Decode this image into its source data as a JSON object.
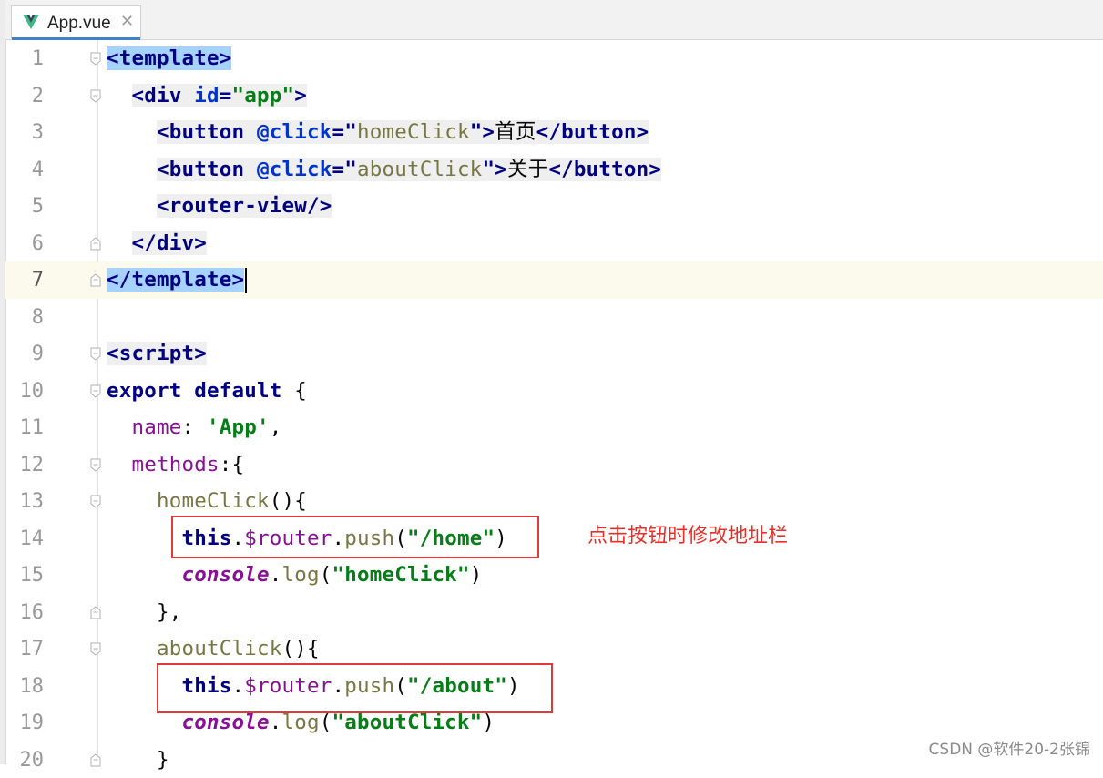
{
  "tab": {
    "file_name": "App.vue",
    "close_glyph": "✕",
    "icon": "vue-logo-icon",
    "accent": "#4083c9"
  },
  "editor": {
    "current_line": 7,
    "lines": [
      {
        "number": "1",
        "tokens": [
          {
            "t": "<template>",
            "c": "tag sel"
          }
        ]
      },
      {
        "number": "2",
        "tokens": [
          {
            "t": "  "
          },
          {
            "t": "<div ",
            "c": "tag bgv"
          },
          {
            "t": "id",
            "c": "attr bgv"
          },
          {
            "t": "=",
            "c": "eq bgv"
          },
          {
            "t": "\"app\"",
            "c": "str bgv"
          },
          {
            "t": ">",
            "c": "tag bgv"
          }
        ]
      },
      {
        "number": "3",
        "tokens": [
          {
            "t": "    "
          },
          {
            "t": "<button ",
            "c": "tag bgv"
          },
          {
            "t": "@click",
            "c": "attr bgv"
          },
          {
            "t": "=\"",
            "c": "eq bgv"
          },
          {
            "t": "homeClick",
            "c": "fn bgv"
          },
          {
            "t": "\">",
            "c": "eq bgv"
          },
          {
            "t": "首页",
            "c": "cjk bgv"
          },
          {
            "t": "</button>",
            "c": "tag bgv"
          }
        ]
      },
      {
        "number": "4",
        "tokens": [
          {
            "t": "    "
          },
          {
            "t": "<button ",
            "c": "tag bgv"
          },
          {
            "t": "@click",
            "c": "attr bgv"
          },
          {
            "t": "=\"",
            "c": "eq bgv"
          },
          {
            "t": "aboutClick",
            "c": "fn bgv"
          },
          {
            "t": "\">",
            "c": "eq bgv"
          },
          {
            "t": "关于",
            "c": "cjk bgv"
          },
          {
            "t": "</button>",
            "c": "tag bgv"
          }
        ]
      },
      {
        "number": "5",
        "tokens": [
          {
            "t": "    "
          },
          {
            "t": "<router-view/>",
            "c": "tag bgv"
          }
        ]
      },
      {
        "number": "6",
        "tokens": [
          {
            "t": "  "
          },
          {
            "t": "</div>",
            "c": "tag bgv"
          }
        ]
      },
      {
        "number": "7",
        "tokens": [
          {
            "t": "</template>",
            "c": "tag sel"
          }
        ]
      },
      {
        "number": "8",
        "tokens": []
      },
      {
        "number": "9",
        "tokens": [
          {
            "t": "<script>",
            "c": "tag bgv"
          }
        ]
      },
      {
        "number": "10",
        "tokens": [
          {
            "t": "export default ",
            "c": "kw"
          },
          {
            "t": "{",
            "c": "plain"
          }
        ]
      },
      {
        "number": "11",
        "tokens": [
          {
            "t": "  "
          },
          {
            "t": "name",
            "c": "prop"
          },
          {
            "t": ": ",
            "c": "plain"
          },
          {
            "t": "'App'",
            "c": "str"
          },
          {
            "t": ",",
            "c": "plain"
          }
        ]
      },
      {
        "number": "12",
        "tokens": [
          {
            "t": "  "
          },
          {
            "t": "methods",
            "c": "prop"
          },
          {
            "t": ":{",
            "c": "plain"
          }
        ]
      },
      {
        "number": "13",
        "tokens": [
          {
            "t": "    "
          },
          {
            "t": "homeClick",
            "c": "fn"
          },
          {
            "t": "(){",
            "c": "plain"
          }
        ]
      },
      {
        "number": "14",
        "tokens": [
          {
            "t": "      "
          },
          {
            "t": "this",
            "c": "kw"
          },
          {
            "t": ".",
            "c": "plain"
          },
          {
            "t": "$router",
            "c": "prop"
          },
          {
            "t": ".",
            "c": "plain"
          },
          {
            "t": "push",
            "c": "fn"
          },
          {
            "t": "(",
            "c": "plain"
          },
          {
            "t": "\"/home\"",
            "c": "str"
          },
          {
            "t": ")",
            "c": "plain"
          }
        ]
      },
      {
        "number": "15",
        "tokens": [
          {
            "t": "      "
          },
          {
            "t": "console",
            "c": "ital"
          },
          {
            "t": ".",
            "c": "plain"
          },
          {
            "t": "log",
            "c": "fn"
          },
          {
            "t": "(",
            "c": "plain"
          },
          {
            "t": "\"homeClick\"",
            "c": "str"
          },
          {
            "t": ")",
            "c": "plain"
          }
        ]
      },
      {
        "number": "16",
        "tokens": [
          {
            "t": "    "
          },
          {
            "t": "},",
            "c": "plain"
          }
        ]
      },
      {
        "number": "17",
        "tokens": [
          {
            "t": "    "
          },
          {
            "t": "aboutClick",
            "c": "fn"
          },
          {
            "t": "(){",
            "c": "plain"
          }
        ]
      },
      {
        "number": "18",
        "tokens": [
          {
            "t": "      "
          },
          {
            "t": "this",
            "c": "kw"
          },
          {
            "t": ".",
            "c": "plain"
          },
          {
            "t": "$router",
            "c": "prop"
          },
          {
            "t": ".",
            "c": "plain"
          },
          {
            "t": "push",
            "c": "fn"
          },
          {
            "t": "(",
            "c": "plain"
          },
          {
            "t": "\"/about\"",
            "c": "str"
          },
          {
            "t": ")",
            "c": "plain"
          }
        ]
      },
      {
        "number": "19",
        "tokens": [
          {
            "t": "      "
          },
          {
            "t": "console",
            "c": "ital"
          },
          {
            "t": ".",
            "c": "plain"
          },
          {
            "t": "log",
            "c": "fn"
          },
          {
            "t": "(",
            "c": "plain"
          },
          {
            "t": "\"aboutClick\"",
            "c": "str"
          },
          {
            "t": ")",
            "c": "plain"
          }
        ]
      },
      {
        "number": "20",
        "tokens": [
          {
            "t": "    "
          },
          {
            "t": "}",
            "c": "plain"
          }
        ]
      }
    ]
  },
  "annotation": {
    "text": "点击按钮时修改地址栏",
    "color": "#e8302a"
  },
  "watermark": {
    "text": "CSDN @软件20-2张锦"
  }
}
